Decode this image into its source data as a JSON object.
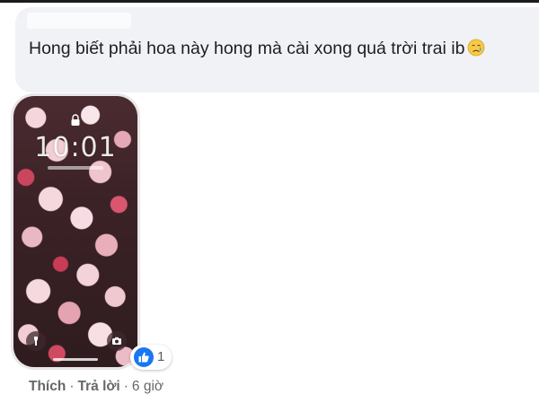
{
  "comment": {
    "author_name_hidden": true,
    "text": "Hong biết phải hoa này hong mà cài xong quá trời trai ib",
    "emoji": "sad-tear-emoji"
  },
  "attachment": {
    "type": "phone-lockscreen-screenshot",
    "clock_time": "10:01",
    "icons": [
      "lock-icon",
      "flashlight-icon",
      "camera-icon"
    ]
  },
  "reactions": {
    "icon": "like-icon",
    "count": "1"
  },
  "actions": {
    "like_label": "Thích",
    "reply_label": "Trả lời",
    "separator": "·",
    "timestamp": "6 giờ"
  },
  "colors": {
    "bubble_bg": "#f0f2f5",
    "text": "#1c1e21",
    "muted": "#65676b",
    "like_blue": "#1877f2"
  }
}
